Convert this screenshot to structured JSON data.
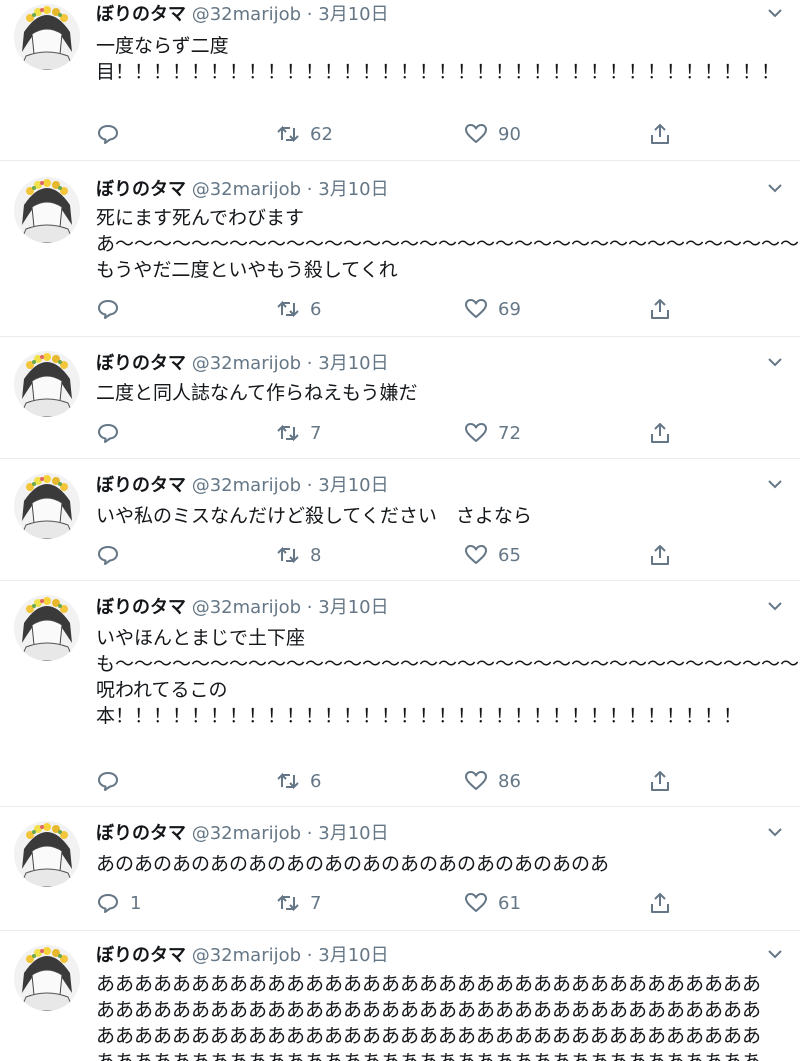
{
  "tweets": [
    {
      "name": "ぼりのタマ",
      "handle": "@32marijob",
      "sep": "·",
      "date": "3月10日",
      "text": "一度ならず二度\n目！！！！！！！！！！！！！！！！！！！！！！！！！！！！！！！！！！！",
      "replies": "",
      "retweets": "62",
      "likes": "90"
    },
    {
      "name": "ぼりのタマ",
      "handle": "@32marijob",
      "sep": "·",
      "date": "3月10日",
      "text": "死にます死んでわびますあ〜〜〜〜〜〜〜〜〜〜〜〜〜〜〜〜〜〜〜〜〜〜〜〜〜〜〜〜〜〜〜〜〜〜〜〜〜〜〜〜〜〜〜〜〜〜〜〜〜〜〜〜もうやだ二度といやもう殺してくれ",
      "replies": "",
      "retweets": "6",
      "likes": "69"
    },
    {
      "name": "ぼりのタマ",
      "handle": "@32marijob",
      "sep": "·",
      "date": "3月10日",
      "text": "二度と同人誌なんて作らねえもう嫌だ",
      "replies": "",
      "retweets": "7",
      "likes": "72"
    },
    {
      "name": "ぼりのタマ",
      "handle": "@32marijob",
      "sep": "·",
      "date": "3月10日",
      "text": "いや私のミスなんだけど殺してください　さよなら",
      "replies": "",
      "retweets": "8",
      "likes": "65"
    },
    {
      "name": "ぼりのタマ",
      "handle": "@32marijob",
      "sep": "·",
      "date": "3月10日",
      "text": "いやほんとまじで土下座も〜〜〜〜〜〜〜〜〜〜〜〜〜〜〜〜〜〜〜〜〜〜〜〜〜〜〜〜〜〜〜〜〜〜〜〜〜〜〜〜〜〜〜〜〜〜〜〜呪われてるこの\n本！！！！！！！！！！！！！！！！！！！！！！！！！！！！！！！！！",
      "replies": "",
      "retweets": "6",
      "likes": "86"
    },
    {
      "name": "ぼりのタマ",
      "handle": "@32marijob",
      "sep": "·",
      "date": "3月10日",
      "text": "あのあのあのあのあのあのあのあのあのあのあのあのあのあ",
      "replies": "1",
      "retweets": "7",
      "likes": "61"
    },
    {
      "name": "ぼりのタマ",
      "handle": "@32marijob",
      "sep": "·",
      "date": "3月10日",
      "text": "あああああああああああああああああああああああああああああああああああああああああああああああああああああああああああああああああああああああああああああああああああああああああああああああああああああああああああああああああああああああああああああああああああああああああああああああああああああああああああ",
      "replies": "",
      "retweets": "",
      "likes": ""
    }
  ]
}
